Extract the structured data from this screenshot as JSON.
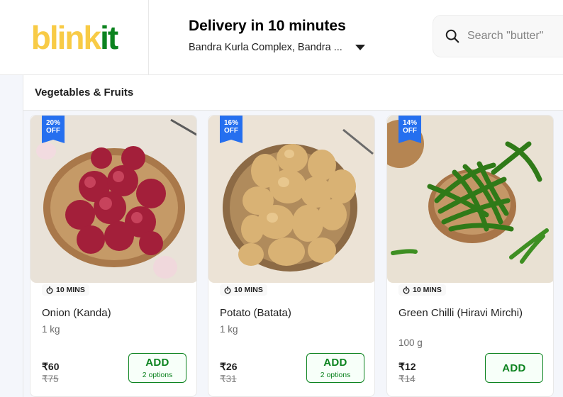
{
  "header": {
    "logo_part1": "blink",
    "logo_part2": "it",
    "delivery_title": "Delivery in 10 minutes",
    "address": "Bandra Kurla Complex, Bandra ...",
    "search_placeholder": "Search \"butter\""
  },
  "section": {
    "title": "Vegetables & Fruits"
  },
  "products": [
    {
      "discount_line1": "20%",
      "discount_line2": "OFF",
      "eta": "10 MINS",
      "name": "Onion (Kanda)",
      "weight": "1 kg",
      "price": "₹60",
      "mrp": "₹75",
      "add_label": "ADD",
      "options": "2 options"
    },
    {
      "discount_line1": "16%",
      "discount_line2": "OFF",
      "eta": "10 MINS",
      "name": "Potato (Batata)",
      "weight": "1 kg",
      "price": "₹26",
      "mrp": "₹31",
      "add_label": "ADD",
      "options": "2 options"
    },
    {
      "discount_line1": "14%",
      "discount_line2": "OFF",
      "eta": "10 MINS",
      "name": "Green Chilli (Hiravi Mirchi)",
      "weight": "100 g",
      "price": "₹12",
      "mrp": "₹14",
      "add_label": "ADD",
      "options": ""
    }
  ],
  "colors": {
    "brand_yellow": "#f8cb46",
    "brand_green": "#0c831f",
    "badge_blue": "#256fef"
  }
}
